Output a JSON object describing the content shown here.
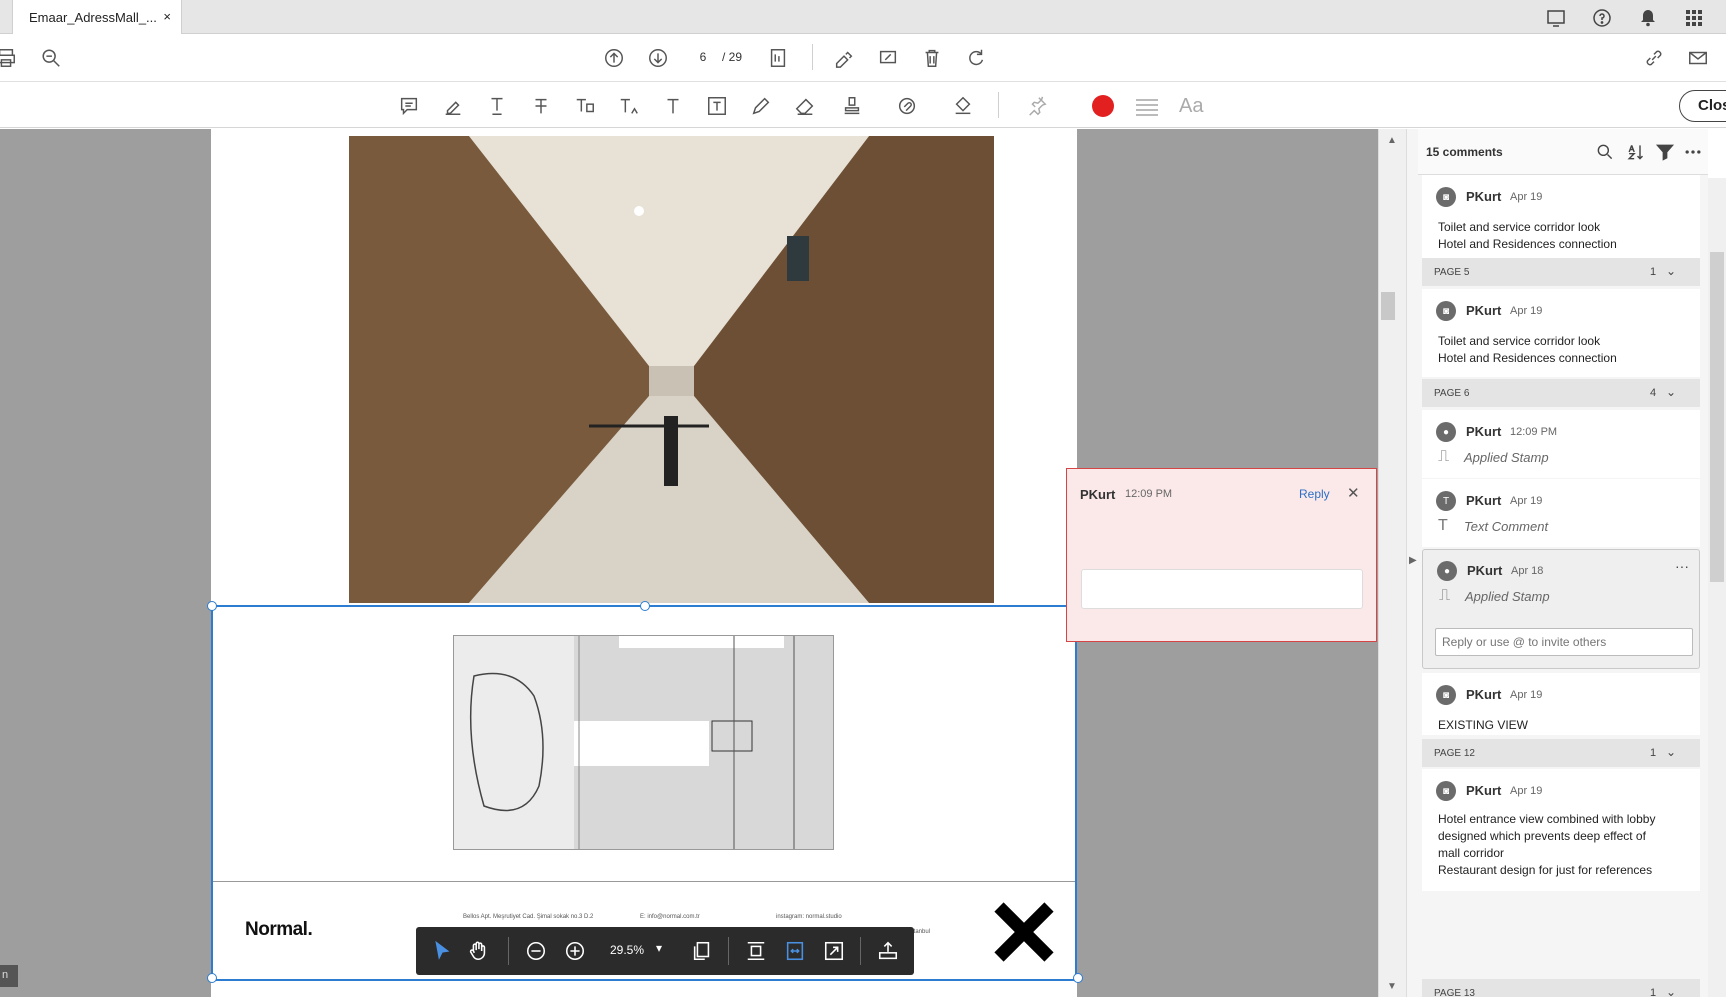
{
  "tab": {
    "title": "Emaar_AdressMall_...",
    "close": "×"
  },
  "navigation": {
    "current_page": "6",
    "total_pages": "/ 29"
  },
  "toolbar": {
    "close_label": "Clos",
    "font_label": "Aa",
    "stamp_color": "#e32020"
  },
  "float_toolbar": {
    "zoom": "29.5%",
    "zoom_caret": "▾"
  },
  "document": {
    "brand": "Normal.",
    "address_1": "Bellos Apt. Meşrutiyet Cad. Şimal sokak no.3 D.2",
    "address_2": "E: info@normal.com.tr",
    "address_3": "instagram: normal.studio",
    "address_4": "İstanbul"
  },
  "popup": {
    "author": "PKurt",
    "time": "12:09 PM",
    "reply": "Reply",
    "close": "✕"
  },
  "comments_panel": {
    "count": "15 comments",
    "items": [
      {
        "author": "PKurt",
        "date": "Apr 19",
        "line1": "Toilet and service corridor look",
        "line2": "Hotel and Residences connection"
      },
      {
        "section": "PAGE 5",
        "count": "1"
      },
      {
        "author": "PKurt",
        "date": "Apr 19",
        "line1": "Toilet and service corridor look",
        "line2": "Hotel and Residences connection"
      },
      {
        "section": "PAGE 6",
        "count": "4"
      },
      {
        "author": "PKurt",
        "date": "12:09 PM",
        "subtext": "Applied Stamp"
      },
      {
        "author": "PKurt",
        "date": "Apr 19",
        "subtext": "Text Comment"
      },
      {
        "author": "PKurt",
        "date": "Apr 18",
        "subtext": "Applied Stamp",
        "more": "···",
        "reply_placeholder": "Reply or use @ to invite others"
      },
      {
        "author": "PKurt",
        "date": "Apr 19",
        "line1": "EXISTING VIEW"
      },
      {
        "section": "PAGE 12",
        "count": "1"
      },
      {
        "author": "PKurt",
        "date": "Apr 19",
        "line1": "Hotel entrance view combined with lobby",
        "line2": "designed which prevents deep effect of",
        "line3": "mall corridor",
        "line4": "Restaurant design for just for references"
      },
      {
        "section": "PAGE 13",
        "count": "1"
      }
    ]
  },
  "bottom_left": "n"
}
